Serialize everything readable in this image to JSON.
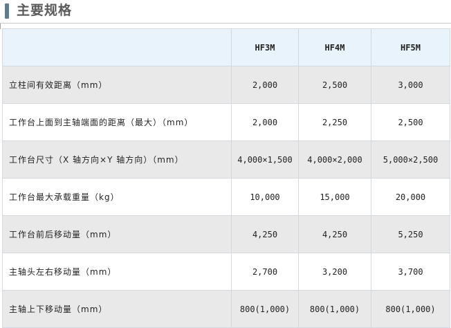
{
  "section": {
    "title": "主要规格"
  },
  "table": {
    "models": [
      "HF3M",
      "HF4M",
      "HF5M"
    ],
    "rows": [
      {
        "label": "立柱间有效距离（mm）",
        "values": [
          "2,000",
          "2,500",
          "3,000"
        ]
      },
      {
        "label": "工作台上面到主轴端面的距离（最大）（mm）",
        "values": [
          "2,000",
          "2,250",
          "2,500"
        ]
      },
      {
        "label": "工作台尺寸（X 轴方向×Y 轴方向）（mm）",
        "values": [
          "4,000×1,500",
          "4,000×2,000",
          "5,000×2,500"
        ]
      },
      {
        "label": "工作台最大承载重量（kg）",
        "values": [
          "10,000",
          "15,000",
          "20,000"
        ]
      },
      {
        "label": "工作台前后移动量（mm）",
        "values": [
          "4,250",
          "4,250",
          "5,250"
        ]
      },
      {
        "label": "主轴头左右移动量（mm）",
        "values": [
          "2,700",
          "3,200",
          "3,700"
        ]
      },
      {
        "label": "主轴上下移动量（mm）",
        "values": [
          "800(1,000)",
          "800(1,000)",
          "800(1,000)"
        ]
      }
    ]
  },
  "colors": {
    "header_bar": "#5e7c8e",
    "header_row_bg": "#e9f3fb",
    "shaded_row_bg": "#e9e9e9",
    "border": "#d2d8de"
  }
}
